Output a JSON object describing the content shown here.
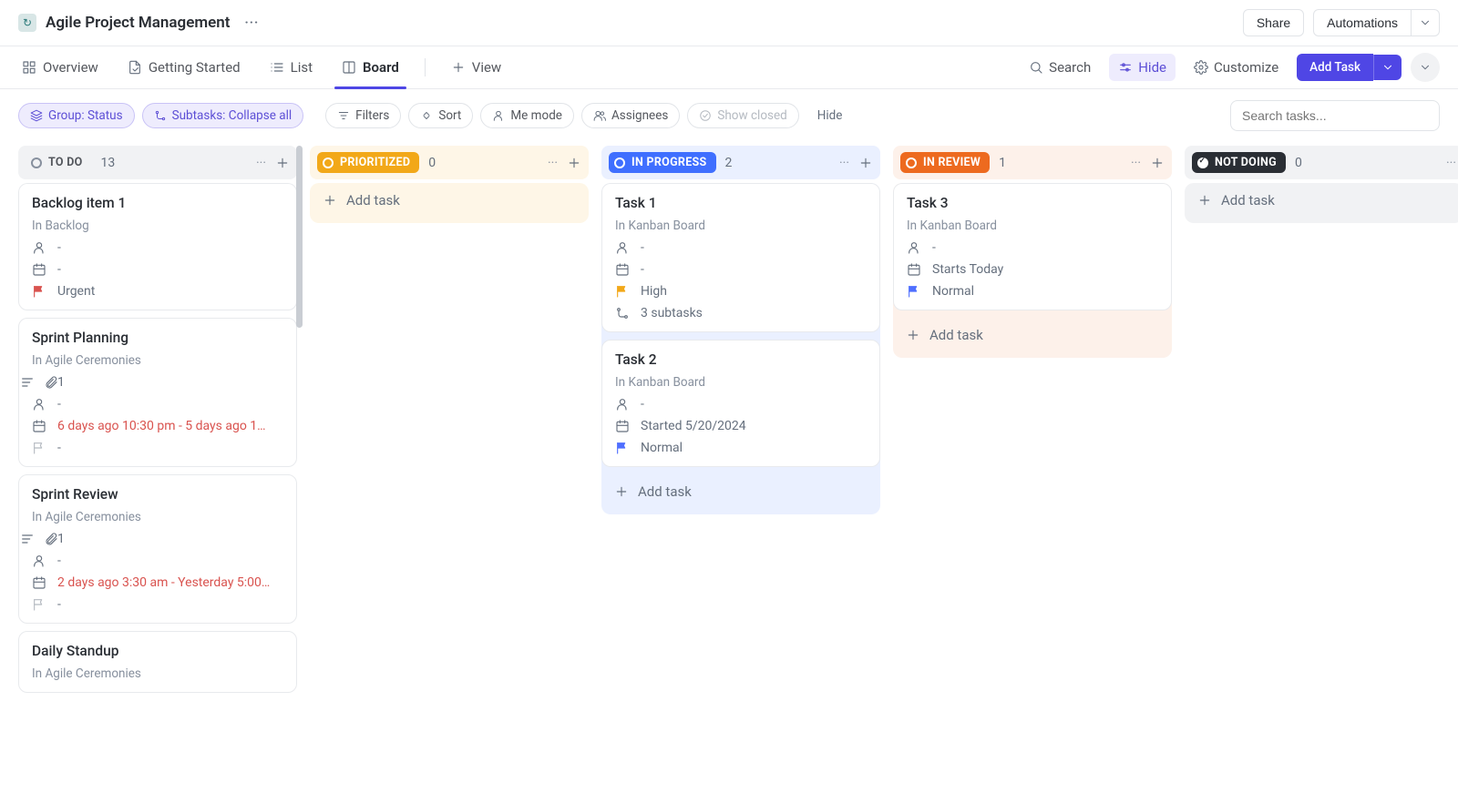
{
  "header": {
    "title": "Agile Project Management",
    "share": "Share",
    "automations": "Automations"
  },
  "tabs": {
    "overview": "Overview",
    "getting_started": "Getting Started",
    "list": "List",
    "board": "Board",
    "view": "View",
    "search": "Search",
    "hide": "Hide",
    "customize": "Customize",
    "add_task": "Add Task"
  },
  "filters": {
    "group": "Group: Status",
    "subtasks": "Subtasks: Collapse all",
    "filters": "Filters",
    "sort": "Sort",
    "me_mode": "Me mode",
    "assignees": "Assignees",
    "show_closed": "Show closed",
    "hide": "Hide",
    "search_placeholder": "Search tasks..."
  },
  "add_task_label": "Add task",
  "columns": [
    {
      "key": "todo",
      "name": "TO DO",
      "count": "13",
      "pill_class": "todo",
      "body_class": "bg-todo",
      "cards": [
        {
          "title": "Backlog item 1",
          "sub": "In Backlog",
          "rows": [
            {
              "icon": "user",
              "text": "-"
            },
            {
              "icon": "cal",
              "text": "-"
            },
            {
              "icon": "flag",
              "flag_class": "red",
              "text": "Urgent"
            }
          ]
        },
        {
          "title": "Sprint Planning",
          "sub": "In Agile Ceremonies",
          "rows": [
            {
              "icon": "desc-attach",
              "text": "1"
            },
            {
              "icon": "user",
              "text": "-"
            },
            {
              "icon": "cal",
              "text": "6 days ago 10:30 pm - 5 days ago 1…",
              "red": true
            },
            {
              "icon": "flag",
              "flag_class": "gray",
              "text": "-"
            }
          ]
        },
        {
          "title": "Sprint Review",
          "sub": "In Agile Ceremonies",
          "rows": [
            {
              "icon": "desc-attach",
              "text": "1"
            },
            {
              "icon": "user",
              "text": "-"
            },
            {
              "icon": "cal",
              "text": "2 days ago 3:30 am - Yesterday 5:00…",
              "red": true
            },
            {
              "icon": "flag",
              "flag_class": "gray",
              "text": "-"
            }
          ]
        },
        {
          "title": "Daily Standup",
          "sub": "In Agile Ceremonies",
          "rows": []
        }
      ]
    },
    {
      "key": "prio",
      "name": "PRIORITIZED",
      "count": "0",
      "pill_class": "prio",
      "body_class": "bg-prio",
      "cards": []
    },
    {
      "key": "prog",
      "name": "IN PROGRESS",
      "count": "2",
      "pill_class": "prog",
      "body_class": "bg-prog",
      "cards": [
        {
          "title": "Task 1",
          "sub": "In Kanban Board",
          "rows": [
            {
              "icon": "user",
              "text": "-"
            },
            {
              "icon": "cal",
              "text": "-"
            },
            {
              "icon": "flag",
              "flag_class": "yellow",
              "text": "High"
            },
            {
              "icon": "subtask",
              "text": "3 subtasks"
            }
          ]
        },
        {
          "title": "Task 2",
          "sub": "In Kanban Board",
          "rows": [
            {
              "icon": "user",
              "text": "-"
            },
            {
              "icon": "cal",
              "text": "Started 5/20/2024"
            },
            {
              "icon": "flag",
              "flag_class": "blue",
              "text": "Normal"
            }
          ]
        }
      ]
    },
    {
      "key": "rev",
      "name": "IN REVIEW",
      "count": "1",
      "pill_class": "rev",
      "body_class": "bg-rev",
      "cards": [
        {
          "title": "Task 3",
          "sub": "In Kanban Board",
          "rows": [
            {
              "icon": "user",
              "text": "-"
            },
            {
              "icon": "cal",
              "text": "Starts Today"
            },
            {
              "icon": "flag",
              "flag_class": "blue",
              "text": "Normal"
            }
          ]
        }
      ]
    },
    {
      "key": "not",
      "name": "NOT DOING",
      "count": "0",
      "pill_class": "not",
      "body_class": "bg-not",
      "cards": []
    }
  ]
}
